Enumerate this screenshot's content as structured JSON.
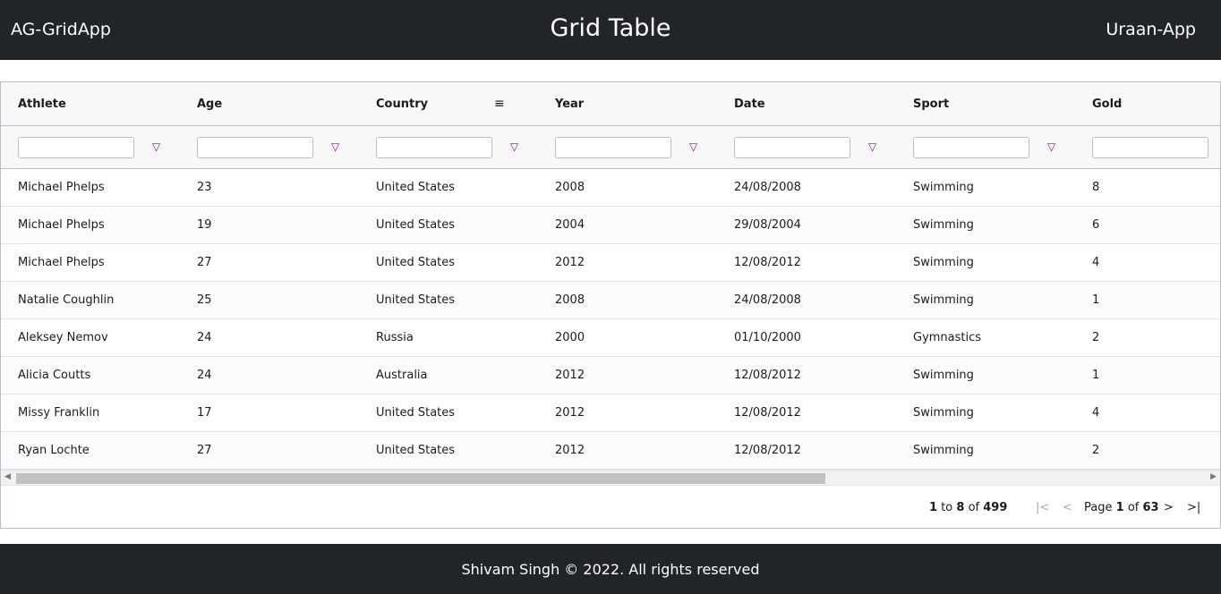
{
  "navbar": {
    "brand": "AG-GridApp",
    "title": "Grid Table",
    "right_link": "Uraan-App"
  },
  "grid": {
    "columns": [
      "Athlete",
      "Age",
      "Country",
      "Year",
      "Date",
      "Sport",
      "Gold"
    ],
    "rows": [
      [
        "Michael Phelps",
        "23",
        "United States",
        "2008",
        "24/08/2008",
        "Swimming",
        "8"
      ],
      [
        "Michael Phelps",
        "19",
        "United States",
        "2004",
        "29/08/2004",
        "Swimming",
        "6"
      ],
      [
        "Michael Phelps",
        "27",
        "United States",
        "2012",
        "12/08/2012",
        "Swimming",
        "4"
      ],
      [
        "Natalie Coughlin",
        "25",
        "United States",
        "2008",
        "24/08/2008",
        "Swimming",
        "1"
      ],
      [
        "Aleksey Nemov",
        "24",
        "Russia",
        "2000",
        "01/10/2000",
        "Gymnastics",
        "2"
      ],
      [
        "Alicia Coutts",
        "24",
        "Australia",
        "2012",
        "12/08/2012",
        "Swimming",
        "1"
      ],
      [
        "Missy Franklin",
        "17",
        "United States",
        "2012",
        "12/08/2012",
        "Swimming",
        "4"
      ],
      [
        "Ryan Lochte",
        "27",
        "United States",
        "2012",
        "12/08/2012",
        "Swimming",
        "2"
      ]
    ],
    "horizontal_scroll_fraction": 0
  },
  "pagination": {
    "from": "1",
    "to_word": "to",
    "to": "8",
    "of_word": "of",
    "total": "499",
    "page_word": "Page",
    "page": "1",
    "page_of": "of",
    "pages": "63"
  },
  "footer": {
    "text": "Shivam Singh © 2022. All rights reserved"
  }
}
